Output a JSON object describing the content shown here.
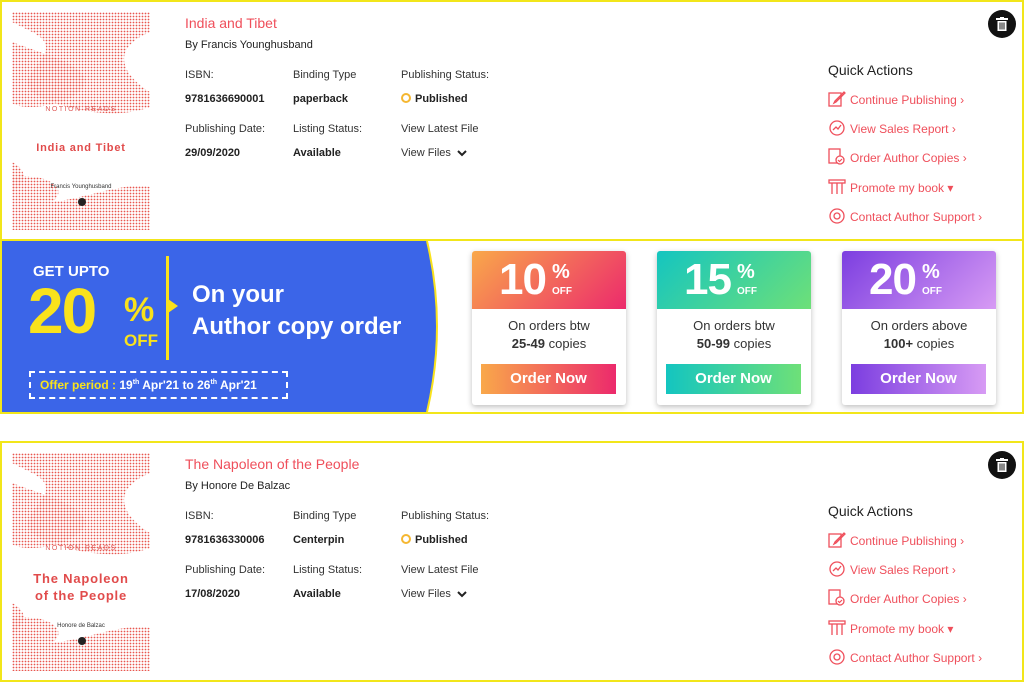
{
  "books": [
    {
      "title": "India and Tibet",
      "author": "By Francis Younghusband",
      "cover": {
        "brand": "NOTION READS",
        "title": "India and Tibet",
        "author": "Francis Younghusband"
      },
      "isbn_label": "ISBN:",
      "isbn": "9781636690001",
      "binding_label": "Binding Type",
      "binding": "paperback",
      "pubstatus_label": "Publishing Status:",
      "pubstatus": "Published",
      "pubdate_label": "Publishing Date:",
      "pubdate": "29/09/2020",
      "listing_label": "Listing Status:",
      "listing": "Available",
      "latest_label": "View Latest File",
      "viewfiles": "View Files"
    },
    {
      "title": "The Napoleon of the People",
      "author": "By Honore De Balzac",
      "cover": {
        "brand": "NOTION READS",
        "title_line1": "The Napoleon",
        "title_line2": "of the People",
        "author": "Honore de Balzac"
      },
      "isbn_label": "ISBN:",
      "isbn": "9781636330006",
      "binding_label": "Binding Type",
      "binding": "Centerpin",
      "pubstatus_label": "Publishing Status:",
      "pubstatus": "Published",
      "pubdate_label": "Publishing Date:",
      "pubdate": "17/08/2020",
      "listing_label": "Listing Status:",
      "listing": "Available",
      "latest_label": "View Latest File",
      "viewfiles": "View Files"
    }
  ],
  "quick_actions": {
    "title": "Quick Actions",
    "items": [
      {
        "label": "Continue Publishing",
        "icon": "edit-icon",
        "suffix": "›"
      },
      {
        "label": "View Sales Report",
        "icon": "sales-report-icon",
        "suffix": "›"
      },
      {
        "label": "Order Author Copies",
        "icon": "order-copies-icon",
        "suffix": "›"
      },
      {
        "label": "Promote my book",
        "icon": "promote-icon",
        "suffix": "▾"
      },
      {
        "label": "Contact Author Support",
        "icon": "support-icon",
        "suffix": "›"
      }
    ]
  },
  "promo": {
    "get_upto": "GET UPTO",
    "big_number": "20",
    "percent": "%",
    "off": "OFF",
    "line1": "On your",
    "line2": "Author copy order",
    "offer_label": "Offer period :",
    "offer_from": "19",
    "offer_from_sup": "th",
    "offer_from_month": "Apr'21",
    "offer_to_word": "to",
    "offer_to": "26",
    "offer_to_sup": "th",
    "offer_to_month": "Apr'21",
    "colors": {
      "blue": "#3b65e8",
      "yellow": "#f9e21c"
    },
    "deals": [
      {
        "num": "10",
        "pct": "%",
        "off": "OFF",
        "line1": "On orders btw",
        "line2": "25-49",
        "line2b": "copies",
        "button": "Order Now"
      },
      {
        "num": "15",
        "pct": "%",
        "off": "OFF",
        "line1": "On orders btw",
        "line2": "50-99",
        "line2b": "copies",
        "button": "Order Now"
      },
      {
        "num": "20",
        "pct": "%",
        "off": "OFF",
        "line1": "On orders above",
        "line2": "100+",
        "line2b": "copies",
        "button": "Order Now"
      }
    ]
  }
}
